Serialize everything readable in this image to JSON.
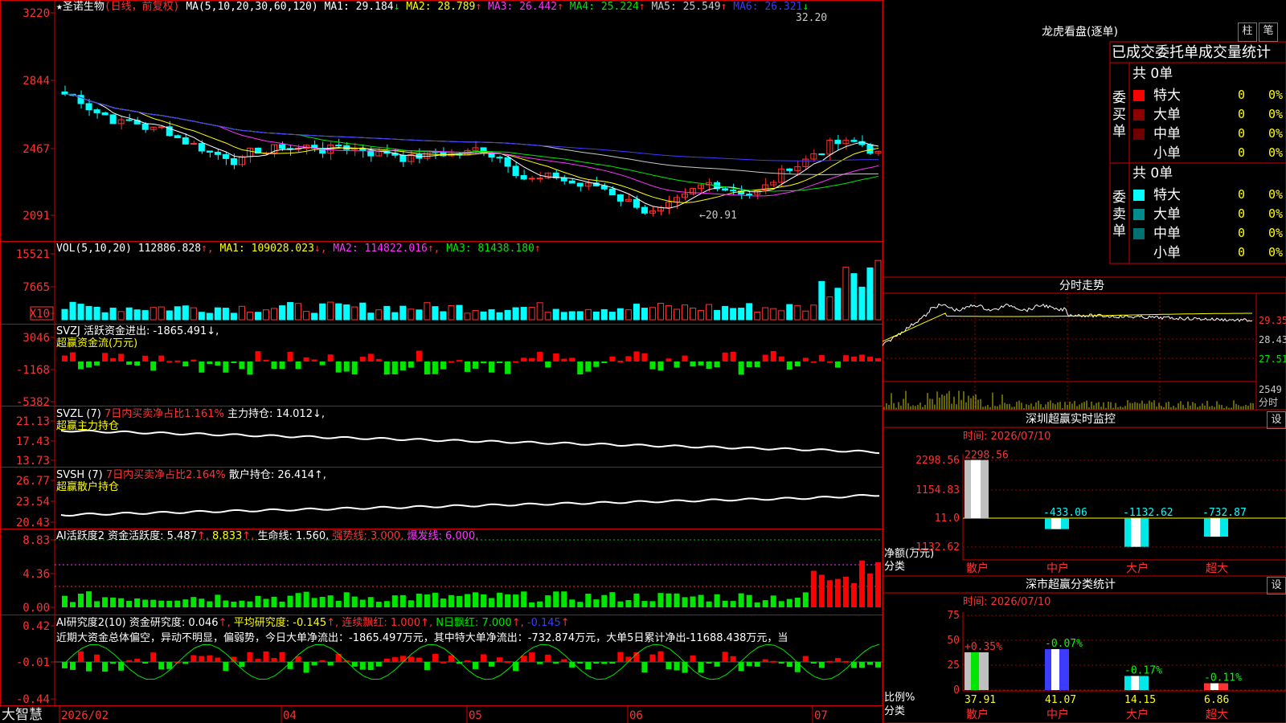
{
  "stock": {
    "name": "★圣诺生物",
    "mode": "(日线，前复权)"
  },
  "ma_header": {
    "prefix": "MA(5,10,20,30,60,120)",
    "items": [
      {
        "label": "MA1:",
        "value": "29.184",
        "arrow": "↓",
        "color": "#ffffff"
      },
      {
        "label": "MA2:",
        "value": "28.789",
        "arrow": "↑",
        "color": "#ffff00"
      },
      {
        "label": "MA3:",
        "value": "26.442",
        "arrow": "↑",
        "color": "#ff32ff"
      },
      {
        "label": "MA4:",
        "value": "25.224",
        "arrow": "↑",
        "color": "#00e600"
      },
      {
        "label": "MA5:",
        "value": "25.549",
        "arrow": "↑",
        "color": "#c8c8c8"
      },
      {
        "label": "MA6:",
        "value": "26.321",
        "arrow": "↓",
        "color": "#3c3cff"
      }
    ]
  },
  "price_axis": [
    "3220",
    "2844",
    "2467",
    "2091"
  ],
  "price_marks": {
    "high": "32.20",
    "low": "←20.91"
  },
  "vol_header": {
    "prefix": "VOL(5,10,20)",
    "value": "112886.828",
    "ma1": "MA1: 109028.023",
    "ma2": "MA2: 114822.016",
    "ma3": "MA3: 81438.180"
  },
  "vol_axis": [
    "15521",
    "7665",
    "X10"
  ],
  "svzj": {
    "title": "SVZJ",
    "label": "活跃资金进出: -1865.491",
    "sub": "超赢资金流(万元)",
    "axis": [
      "3046",
      "-1168",
      "-5382"
    ]
  },
  "svzl": {
    "title": "SVZL (7)",
    "ratio": "7日内买卖净占比1.161%",
    "main": "主力持仓: 14.012",
    "sub": "超赢主力持仓",
    "axis": [
      "21.13",
      "17.43",
      "13.73"
    ]
  },
  "svsh": {
    "title": "SVSH (7)",
    "ratio": "7日内买卖净占比2.164%",
    "main": "散户持仓: 26.414",
    "sub": "超赢散户持仓",
    "axis": [
      "26.77",
      "23.54",
      "20.43"
    ]
  },
  "ai_active": {
    "title": "AI活跃度2",
    "label": "资金活跃度: 5.487",
    "v2": "8.833",
    "life": "生命线: 1.560",
    "strong": "强势线: 3.000",
    "burst": "爆发线: 6.000",
    "axis": [
      "8.83",
      "4.36",
      "0.00"
    ]
  },
  "ai_research": {
    "title": "AI研究度2(10)",
    "label": "资金研究度: 0.046",
    "avg": "平均研究度: -0.145",
    "cont": "连续飘红: 1.000",
    "nday": "N日飘红: 7.000",
    "last": "-0.145",
    "text": "近期大资金总体偏空，异动不明显，偏弱势，今日大单净流出：-1865.497万元，其中特大单净流出：-732.874万元，大单5日累计净出-11688.438万元，当",
    "axis": [
      "0.42",
      "-0.01",
      "-0.44"
    ]
  },
  "bottom_axis": [
    "2026/02",
    "04",
    "05",
    "06",
    "07"
  ],
  "brand": "大智慧",
  "right": {
    "lhb_title": "龙虎看盘(逐单)",
    "tab_zhu": "柱",
    "tab_bi": "笔",
    "stat_title": "已成交委托单成交量统计",
    "buy_total": "共 0单",
    "sell_total": "共 0单",
    "buy_label": "委买单",
    "sell_label": "委卖单",
    "rows": [
      "特大",
      "大单",
      "中单",
      "小单"
    ],
    "buy_colors": [
      "#ff0000",
      "#8c0000",
      "#700000",
      "#000000"
    ],
    "sell_colors": [
      "#00ffff",
      "#008c8c",
      "#007070",
      "#000000"
    ],
    "zero": "0",
    "pct": "0%",
    "fenshi_title": "分时走势",
    "fenshi_axis": [
      "29.35",
      "28.43",
      "27.51"
    ],
    "fenshi_vol": [
      "2549",
      "分时"
    ],
    "sz_title": "深圳超赢实时监控",
    "sz_time": "时间: 2026/07/10",
    "sz_axis": [
      "2298.56",
      "1154.83",
      "11.0",
      "-1132.62"
    ],
    "sz_bars": [
      {
        "label": "散户",
        "value": "2298.56"
      },
      {
        "label": "中户",
        "value": "-433.06"
      },
      {
        "label": "大户",
        "value": "-1132.62"
      },
      {
        "label": "超大",
        "value": "-732.87"
      }
    ],
    "sz_ylabel": "净额(万元)",
    "sz_xlabel": "分类",
    "sc_title": "深市超赢分类统计",
    "sc_time": "时间: 2026/07/10",
    "sc_axis": [
      "75",
      "50",
      "25",
      "0"
    ],
    "sc_bars": [
      {
        "label": "散户",
        "value": "37.91",
        "change": "+0.35%"
      },
      {
        "label": "中户",
        "value": "41.07",
        "change": "-0.07%"
      },
      {
        "label": "大户",
        "value": "14.15",
        "change": "-0.17%"
      },
      {
        "label": "超大",
        "value": "6.86",
        "change": "-0.11%"
      }
    ],
    "sc_ylabel": "比例%",
    "sc_xlabel": "分类",
    "set_btn": "设"
  }
}
